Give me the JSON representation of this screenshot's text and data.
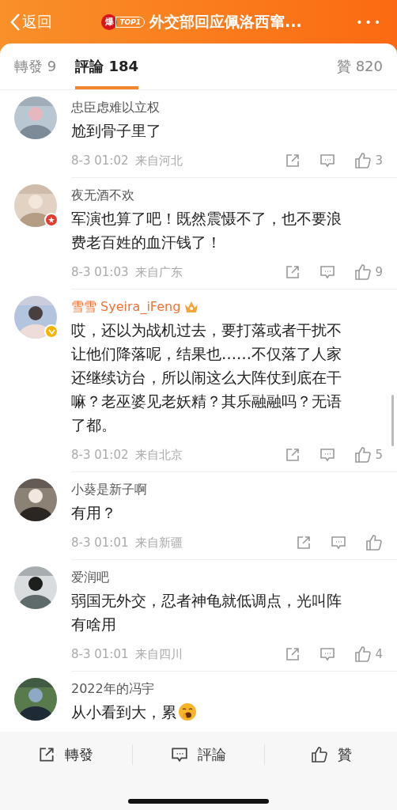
{
  "header": {
    "back_label": "返回",
    "hot_badge": "爆",
    "rank_label": "TOP1",
    "title": "外交部回应佩洛西窜...",
    "more": "•••"
  },
  "tabs": [
    {
      "label": "轉發 9",
      "selected": false
    },
    {
      "label": "評論 184",
      "selected": true
    },
    {
      "label": "贊 820",
      "selected": false
    }
  ],
  "comments": [
    {
      "user": "忠臣虑难以立权",
      "vip": false,
      "red_badge": false,
      "verified": false,
      "text": "尬到骨子里了",
      "time": "8-3 01:02",
      "location": "来自河北",
      "emoji": false,
      "likes": "3"
    },
    {
      "user": "夜无酒不欢",
      "vip": false,
      "red_badge": true,
      "verified": false,
      "text": "军演也算了吧！既然震慑不了，也不要浪费老百姓的血汗钱了！",
      "time": "8-3 01:03",
      "location": "来自广东",
      "emoji": false,
      "likes": "9"
    },
    {
      "user": "雪雪 Syeira_iFeng",
      "vip": true,
      "red_badge": false,
      "verified": true,
      "text": "哎，还以为战机过去，要打落或者干扰不让他们降落呢，结果也……不仅落了人家还继续访台，所以闹这么大阵仗到底在干嘛？老巫婆见老妖精？其乐融融吗？无语了都。",
      "time": "8-3 01:02",
      "location": "来自北京",
      "emoji": false,
      "likes": "5"
    },
    {
      "user": "小葵是新子啊",
      "vip": false,
      "red_badge": false,
      "verified": false,
      "text": "有用？",
      "time": "8-3 01:01",
      "location": "来自新疆",
      "emoji": false
    },
    {
      "user": "爱润吧",
      "vip": false,
      "red_badge": false,
      "verified": false,
      "text": "弱国无外交，忍者神龟就低调点，光叫阵有啥用",
      "time": "8-3 01:01",
      "location": "来自四川",
      "emoji": false,
      "likes": "4"
    },
    {
      "user": "2022年的冯宇",
      "vip": false,
      "red_badge": false,
      "verified": false,
      "text": "从小看到大，累",
      "emoji": true
    }
  ],
  "bottom_bar": [
    {
      "kind": "repost",
      "label": "轉發"
    },
    {
      "kind": "comment",
      "label": "評論"
    },
    {
      "kind": "like",
      "label": "贊"
    }
  ]
}
